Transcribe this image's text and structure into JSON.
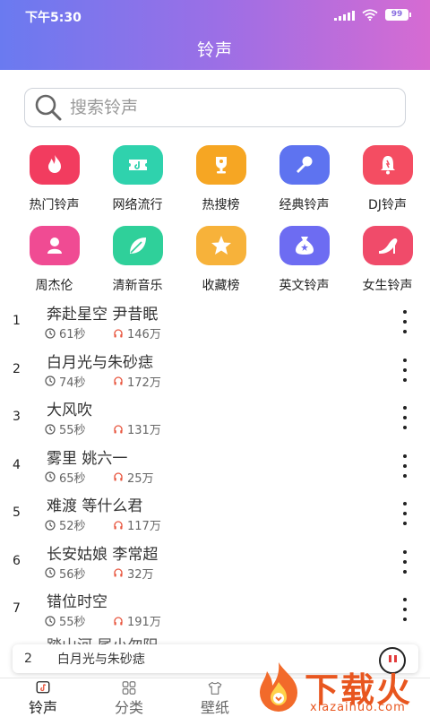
{
  "status_bar": {
    "time": "下午5:30",
    "battery": "99"
  },
  "header": {
    "title": "铃声"
  },
  "search": {
    "placeholder": "搜索铃声"
  },
  "categories": [
    {
      "label": "热门铃声",
      "icon": "flame-icon",
      "color": "#f23c5f"
    },
    {
      "label": "网络流行",
      "icon": "ticket-icon",
      "color": "#2fd2ad"
    },
    {
      "label": "热搜榜",
      "icon": "trophy-icon",
      "color": "#f6a623"
    },
    {
      "label": "经典铃声",
      "icon": "microphone-icon",
      "color": "#5e73f0"
    },
    {
      "label": "DJ铃声",
      "icon": "bell-icon",
      "color": "#f44d62"
    },
    {
      "label": "周杰伦",
      "icon": "person-icon",
      "color": "#f04b93"
    },
    {
      "label": "清新音乐",
      "icon": "leaf-icon",
      "color": "#2fd09a"
    },
    {
      "label": "收藏榜",
      "icon": "star-icon",
      "color": "#f7b23a"
    },
    {
      "label": "英文铃声",
      "icon": "money-bag-icon",
      "color": "#6d6cf2"
    },
    {
      "label": "女生铃声",
      "icon": "high-heel-icon",
      "color": "#f04b6a"
    }
  ],
  "songs": [
    {
      "rank": "1",
      "title": "奔赴星空 尹昔眠",
      "duration": "61秒",
      "plays": "146万"
    },
    {
      "rank": "2",
      "title": "白月光与朱砂痣",
      "duration": "74秒",
      "plays": "172万"
    },
    {
      "rank": "3",
      "title": "大风吹",
      "duration": "55秒",
      "plays": "131万"
    },
    {
      "rank": "4",
      "title": "雾里 姚六一",
      "duration": "65秒",
      "plays": "25万"
    },
    {
      "rank": "5",
      "title": "难渡 等什么君",
      "duration": "52秒",
      "plays": "117万"
    },
    {
      "rank": "6",
      "title": "长安姑娘 李常超",
      "duration": "56秒",
      "plays": "32万"
    },
    {
      "rank": "7",
      "title": "错位时空",
      "duration": "55秒",
      "plays": "191万"
    }
  ],
  "partial_row": {
    "title": "踏山河 尾小勿阳"
  },
  "now_playing": {
    "rank": "2",
    "title": "白月光与朱砂痣"
  },
  "bottom_nav": [
    {
      "label": "铃声",
      "icon": "music-note-icon",
      "active": true
    },
    {
      "label": "分类",
      "icon": "grid-icon",
      "active": false
    },
    {
      "label": "壁纸",
      "icon": "tshirt-icon",
      "active": false
    }
  ],
  "watermark": {
    "text": "下载火",
    "sub": "xiazaihuo.com"
  }
}
